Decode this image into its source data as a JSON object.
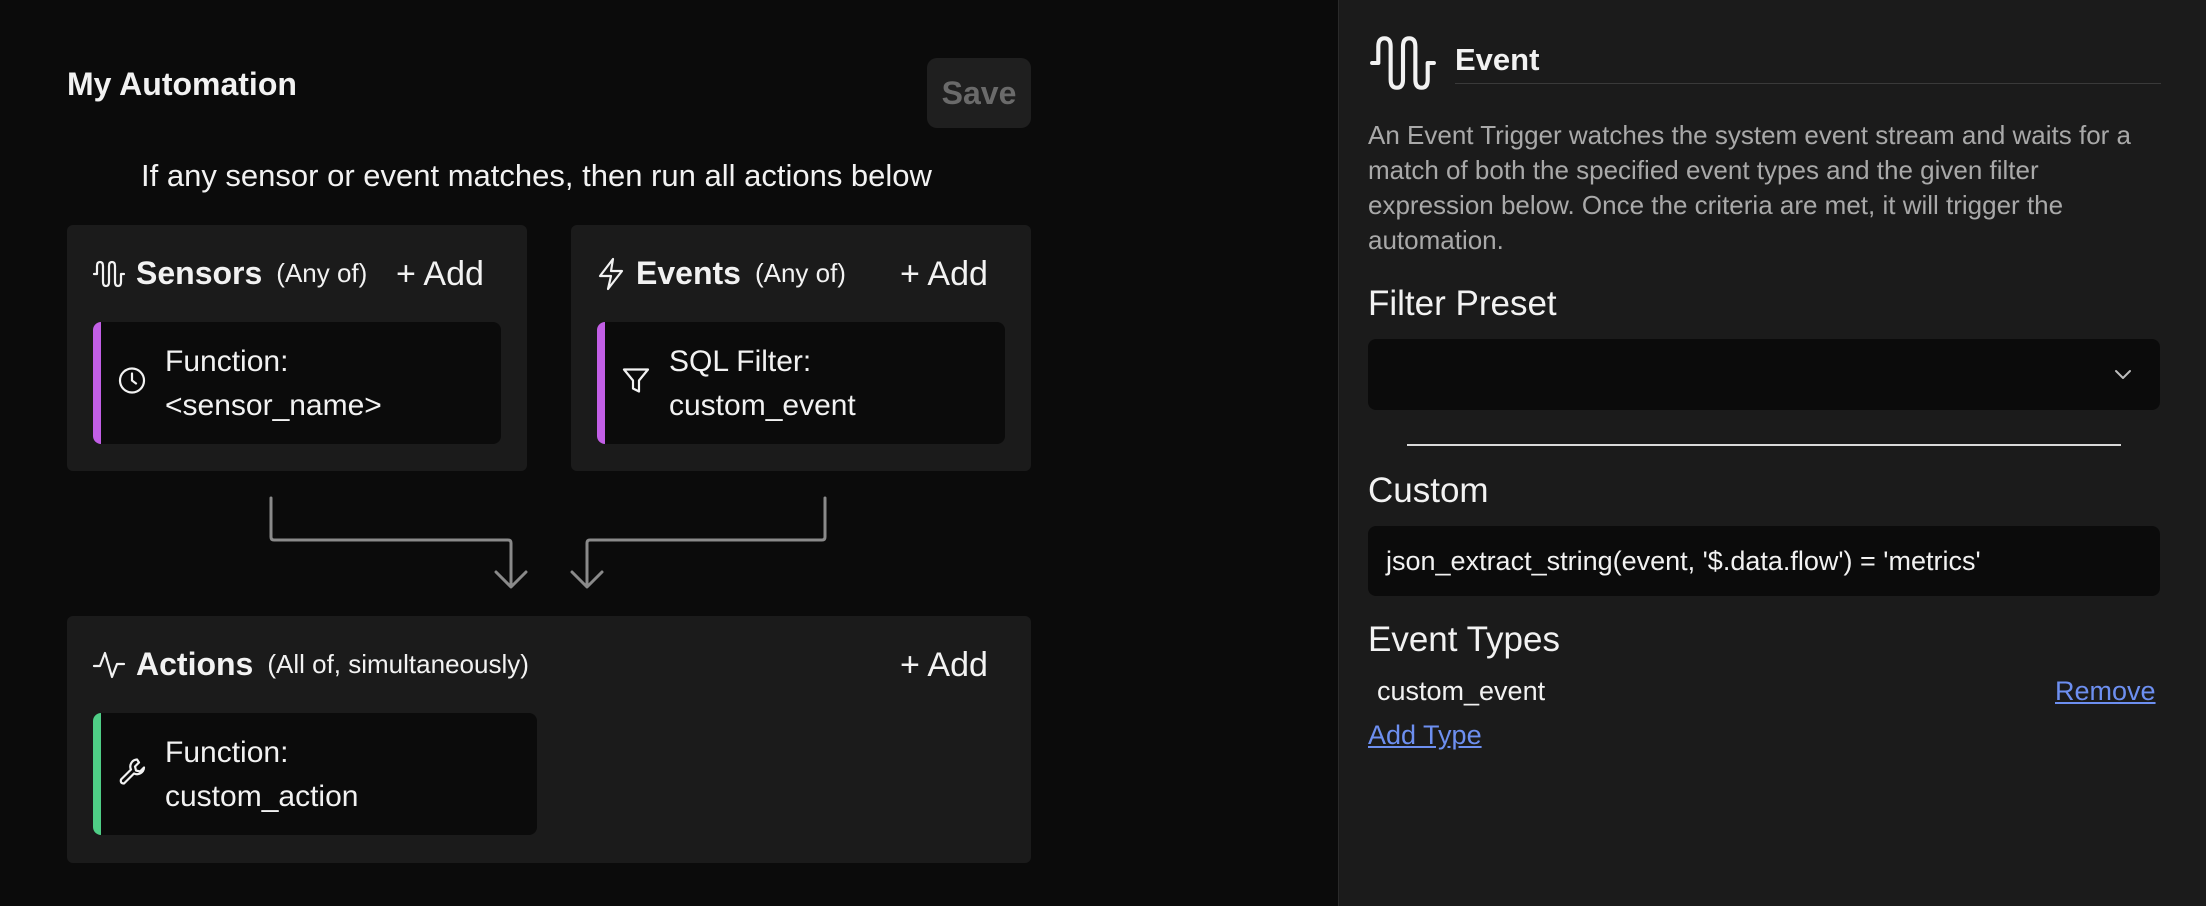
{
  "automation": {
    "title": "My Automation",
    "save_label": "Save",
    "rule_text": "If any sensor or event matches, then run all actions below"
  },
  "sensors": {
    "label": "Sensors",
    "qualifier": "(Any of)",
    "add_label": "+ Add",
    "icon": "waveform-icon",
    "items": [
      {
        "line1": "Function:",
        "line2": "<sensor_name>",
        "icon": "clock-icon",
        "accent": "#c25fe6"
      }
    ]
  },
  "events": {
    "label": "Events",
    "qualifier": "(Any of)",
    "add_label": "+ Add",
    "icon": "lightning-icon",
    "items": [
      {
        "line1": "SQL Filter:",
        "line2": "custom_event",
        "icon": "filter-icon",
        "accent": "#c25fe6"
      }
    ]
  },
  "actions": {
    "label": "Actions",
    "qualifier": "(All of, simultaneously)",
    "add_label": "+ Add",
    "icon": "activity-icon",
    "items": [
      {
        "line1": "Function:",
        "line2": "custom_action",
        "icon": "wrench-icon",
        "accent": "#4fce86"
      }
    ]
  },
  "detail": {
    "title": "Event",
    "icon": "waveform-icon",
    "description": "An Event Trigger watches the system event stream and waits for a match of both the specified event types and the given filter expression below. Once the criteria are met, it will trigger the automation.",
    "filter_preset_label": "Filter Preset",
    "filter_preset_value": "",
    "custom_label": "Custom",
    "custom_value": "json_extract_string(event, '$.data.flow') = 'metrics'",
    "event_types_label": "Event Types",
    "event_types": [
      "custom_event"
    ],
    "remove_label": "Remove",
    "add_type_label": "Add Type"
  },
  "colors": {
    "background": "#0b0b0b",
    "panel": "#1b1b1b",
    "trigger_accent": "#c25fe6",
    "action_accent": "#4fce86",
    "link": "#6d8ff0"
  }
}
